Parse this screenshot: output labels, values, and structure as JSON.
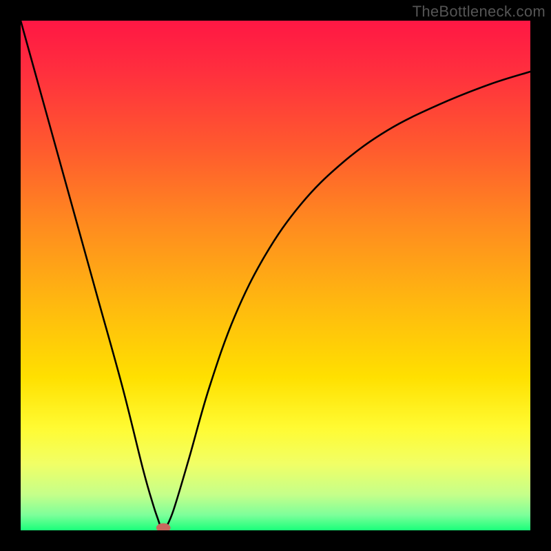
{
  "watermark": "TheBottleneck.com",
  "chart_data": {
    "type": "line",
    "title": "",
    "xlabel": "",
    "ylabel": "",
    "xlim": [
      0,
      100
    ],
    "ylim": [
      0,
      100
    ],
    "background_gradient": {
      "stops": [
        {
          "offset": 0.0,
          "color": "#ff1744"
        },
        {
          "offset": 0.1,
          "color": "#ff2f3e"
        },
        {
          "offset": 0.25,
          "color": "#ff5a2e"
        },
        {
          "offset": 0.4,
          "color": "#ff8b1f"
        },
        {
          "offset": 0.55,
          "color": "#ffb710"
        },
        {
          "offset": 0.7,
          "color": "#ffe000"
        },
        {
          "offset": 0.8,
          "color": "#fffb33"
        },
        {
          "offset": 0.87,
          "color": "#f1ff66"
        },
        {
          "offset": 0.93,
          "color": "#c5ff8a"
        },
        {
          "offset": 0.97,
          "color": "#7dff9a"
        },
        {
          "offset": 1.0,
          "color": "#1aff7a"
        }
      ]
    },
    "series": [
      {
        "name": "left-branch",
        "x": [
          0,
          5,
          10,
          15,
          20,
          24,
          26,
          27,
          27.5
        ],
        "y": [
          100,
          82,
          64,
          46,
          28,
          12,
          5,
          2,
          0.5
        ]
      },
      {
        "name": "right-branch",
        "x": [
          28.5,
          30,
          33,
          37,
          42,
          48,
          55,
          63,
          72,
          82,
          92,
          100
        ],
        "y": [
          0.5,
          4,
          14,
          28,
          42,
          54,
          64,
          72,
          78.5,
          83.5,
          87.5,
          90
        ]
      }
    ],
    "marker": {
      "cx": 28,
      "cy": 0.5,
      "rx": 1.4,
      "ry": 0.9,
      "color": "#c8695e"
    }
  }
}
